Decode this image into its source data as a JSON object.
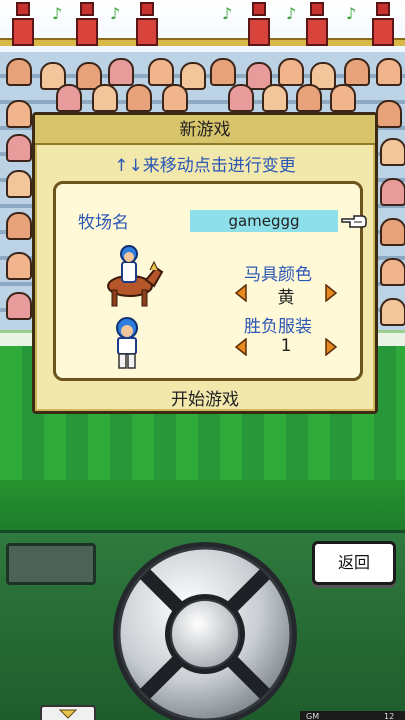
{
  "dialog": {
    "title": "新游戏",
    "hint": "↑↓来移动点击进行变更",
    "farm_name_label": "牧场名",
    "farm_name_value": "gameggg",
    "tack_color_label": "马具颜色",
    "tack_color_value": "黄",
    "silks_label": "胜负服装",
    "silks_value": "1",
    "start_label": "开始游戏"
  },
  "controls": {
    "back_label": "返回",
    "status_left": "GM",
    "status_right": "12"
  },
  "icons": {
    "hand": "pointing-hand-icon",
    "prev": "left-arrow-icon",
    "next": "right-arrow-icon",
    "horse": "horse-rider-icon",
    "jockey": "jockey-icon",
    "tab": "down-arrow-icon"
  },
  "colors": {
    "accent_text": "#2b57b5",
    "name_field": "#8de0ea",
    "arrow_orange": "#e68a1f",
    "dialog_bg": "#f2e8ac"
  }
}
